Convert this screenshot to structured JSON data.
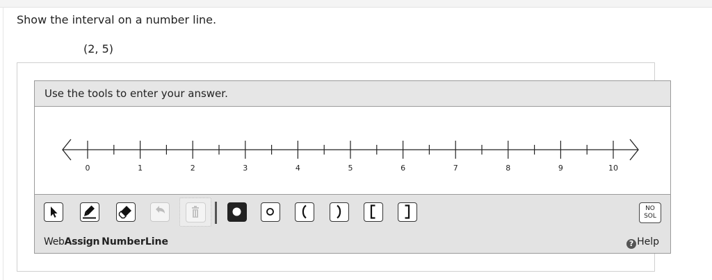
{
  "question": {
    "prompt": "Show the interval on a number line.",
    "interval": "(2, 5)"
  },
  "widget": {
    "instruction": "Use the tools to enter your answer.",
    "number_line": {
      "min": 0,
      "max": 10,
      "major_step": 1,
      "minor_step": 0.5,
      "labels": [
        "0",
        "1",
        "2",
        "3",
        "4",
        "5",
        "6",
        "7",
        "8",
        "9",
        "10"
      ]
    },
    "tools": [
      {
        "name": "select-tool",
        "icon": "arrow-pointer-icon"
      },
      {
        "name": "draw-tool",
        "icon": "pencil-icon"
      },
      {
        "name": "eraser-tool",
        "icon": "eraser-icon"
      },
      {
        "name": "undo-tool",
        "icon": "undo-icon",
        "disabled": true
      },
      {
        "name": "delete-tool",
        "icon": "trash-icon",
        "disabled": true
      },
      {
        "name": "closed-point-tool",
        "icon": "filled-circle-icon"
      },
      {
        "name": "open-point-tool",
        "icon": "open-circle-icon"
      },
      {
        "name": "left-paren-tool",
        "symbol": "("
      },
      {
        "name": "right-paren-tool",
        "symbol": ")"
      },
      {
        "name": "left-bracket-tool",
        "symbol": "["
      },
      {
        "name": "right-bracket-tool",
        "symbol": "]"
      }
    ],
    "no_solution": {
      "line1": "NO",
      "line2": "SOL"
    },
    "footer": {
      "brand_web": "Web",
      "brand_assign": "Assign",
      "brand_product": "NumberLine",
      "help_label": "Help"
    }
  }
}
